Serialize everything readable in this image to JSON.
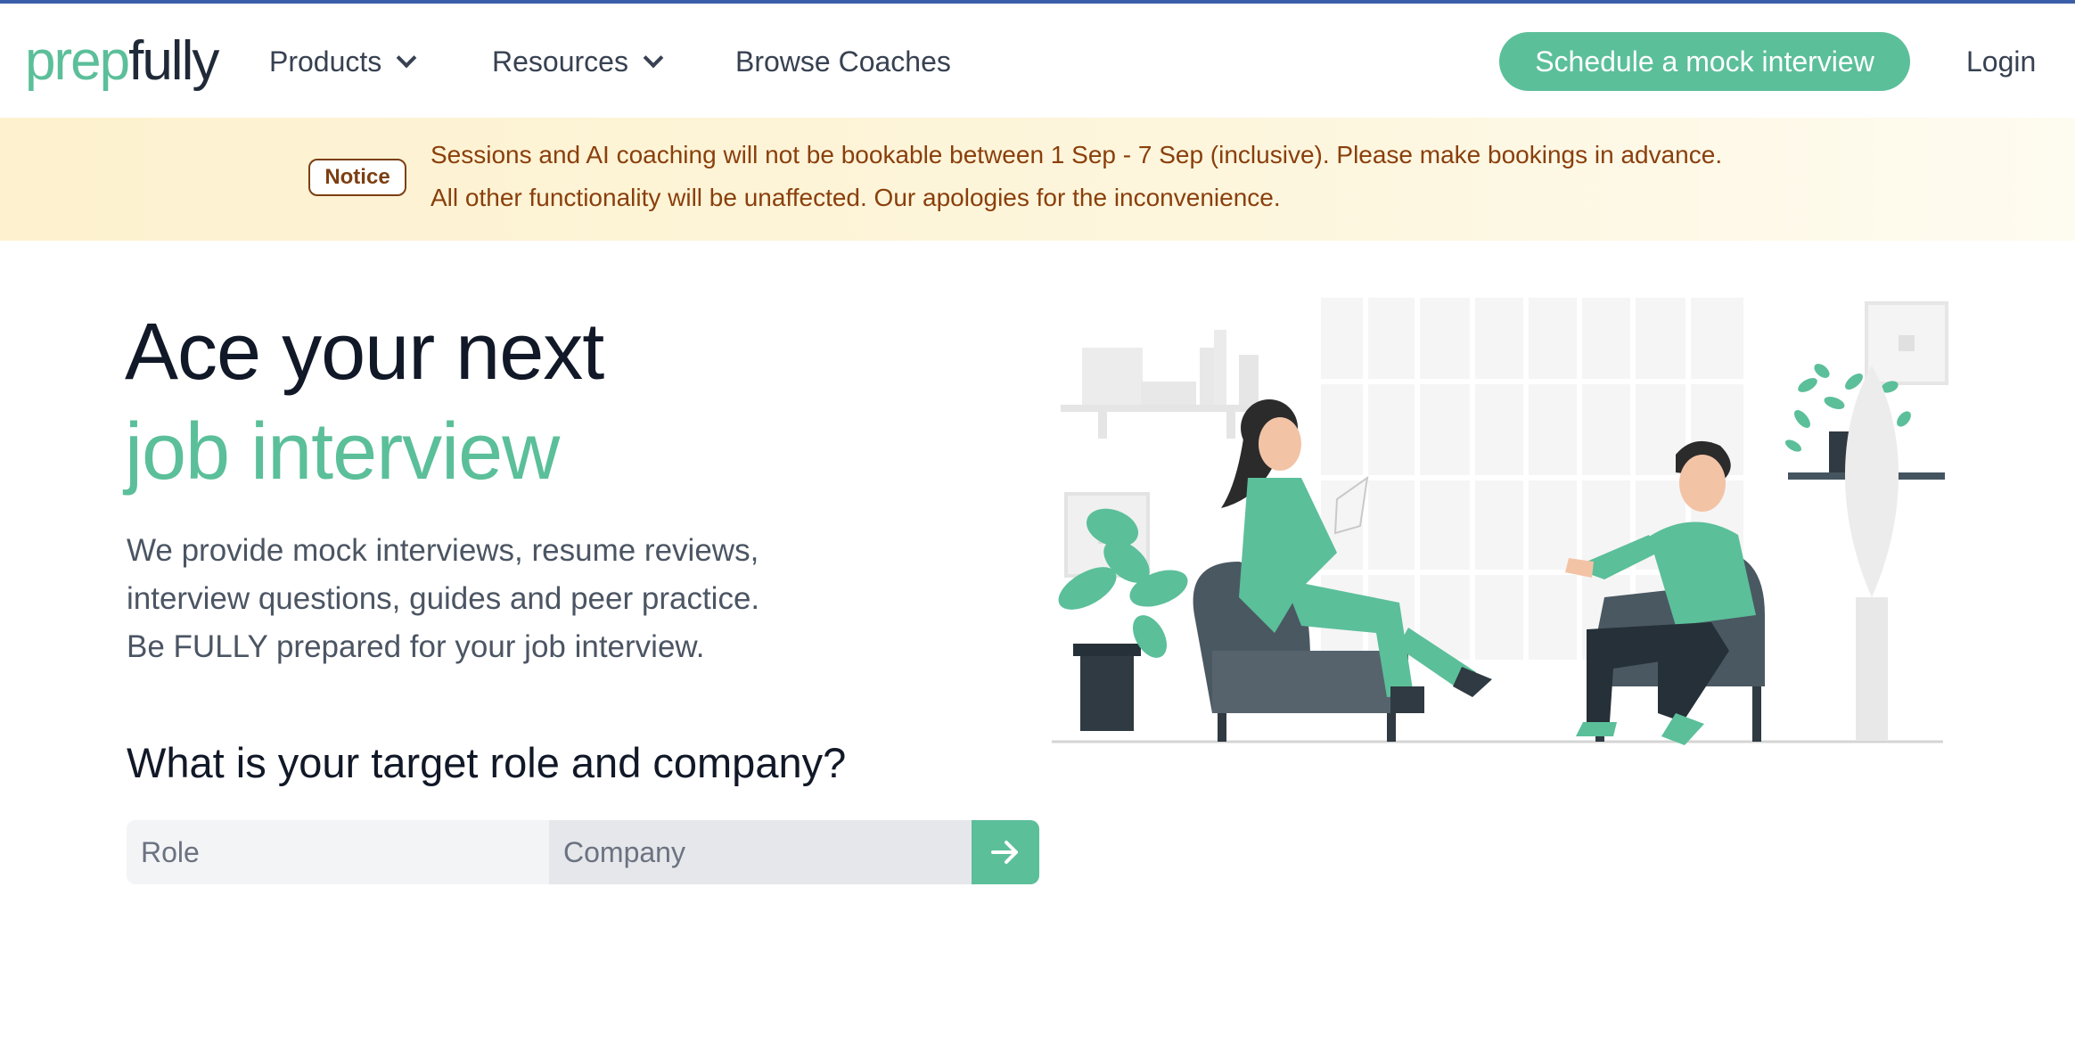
{
  "brand": {
    "logo_part1": "prep",
    "logo_part2": "fully"
  },
  "nav": {
    "products_label": "Products",
    "resources_label": "Resources",
    "browse_label": "Browse Coaches",
    "cta_label": "Schedule a mock interview",
    "login_label": "Login"
  },
  "notice": {
    "badge": "Notice",
    "line1": "Sessions and AI coaching will not be bookable between 1 Sep - 7 Sep (inclusive). Please make bookings in advance.",
    "line2": "All other functionality will be unaffected. Our apologies for the inconvenience."
  },
  "hero": {
    "title_line1": "Ace your next",
    "title_line2": "job interview",
    "desc_line1": "We provide mock interviews, resume reviews,",
    "desc_line2": "interview questions, guides and peer practice.",
    "desc_line3": "Be FULLY prepared for your job interview.",
    "question": "What is your target role and company?"
  },
  "search": {
    "role_placeholder": "Role",
    "company_placeholder": "Company",
    "submit_icon": "arrow-right-icon"
  },
  "colors": {
    "brand_green": "#5bbf9a",
    "notice_text": "#8a3f0c",
    "top_line": "#3b5ea8"
  }
}
